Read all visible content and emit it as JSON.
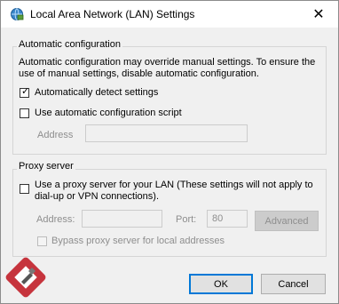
{
  "window": {
    "title": "Local Area Network (LAN) Settings",
    "close_glyph": "✕"
  },
  "auto_config": {
    "group_label": "Automatic configuration",
    "description_line1": "Automatic configuration may override manual settings.  To ensure the",
    "description_line2": "use of manual settings, disable automatic configuration.",
    "auto_detect": {
      "label": "Automatically detect settings",
      "checked": true
    },
    "use_script": {
      "label": "Use automatic configuration script",
      "checked": false
    },
    "address_label": "Address",
    "address_value": ""
  },
  "proxy": {
    "group_label": "Proxy server",
    "use_proxy": {
      "label_line1": "Use a proxy server for your LAN (These settings will not apply to",
      "label_line2": "dial-up or VPN connections).",
      "checked": false
    },
    "address_label": "Address:",
    "address_value": "",
    "port_label": "Port:",
    "port_value": "80",
    "advanced_label": "Advanced",
    "bypass_label": "Bypass proxy server for local addresses",
    "bypass_checked": false
  },
  "buttons": {
    "ok_label": "OK",
    "cancel_label": "Cancel"
  }
}
